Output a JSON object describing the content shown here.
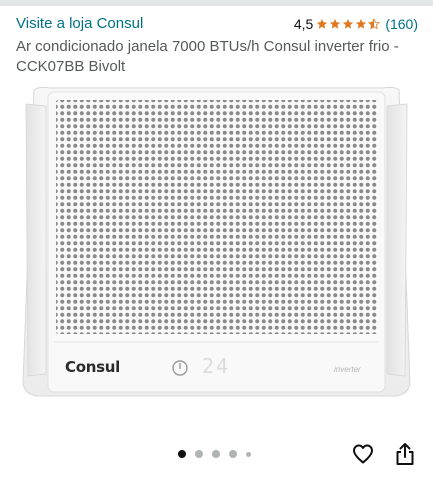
{
  "header": {
    "store_link": "Visite a loja Consul",
    "rating_value": "4,5",
    "rating_stars": 4.5,
    "rating_count": "(160)",
    "star_color": "#f3a847"
  },
  "product": {
    "title": "Ar condicionado janela 7000 BTUs/h Consul inverter frio - CCK07BB Bivolt",
    "image": {
      "brand_logo": "Consul",
      "display_temp": "24",
      "badge": "inverter"
    }
  },
  "carousel": {
    "total_dots": 5,
    "active_index": 0
  },
  "actions": {
    "wishlist_icon": "heart-icon",
    "share_icon": "share-icon"
  }
}
